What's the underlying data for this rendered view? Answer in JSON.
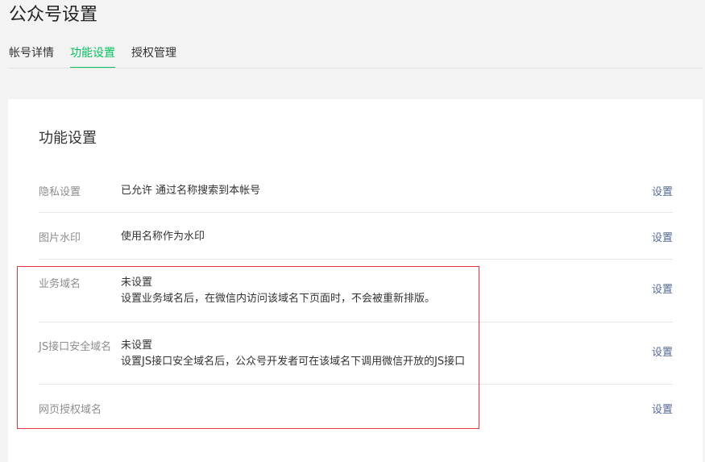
{
  "page_title": "公众号设置",
  "tabs": [
    {
      "label": "帐号详情",
      "active": false
    },
    {
      "label": "功能设置",
      "active": true
    },
    {
      "label": "授权管理",
      "active": false
    }
  ],
  "section_title": "功能设置",
  "rows": [
    {
      "label": "隐私设置",
      "value_line1": "已允许 通过名称搜索到本帐号",
      "value_line2": "",
      "action": "设置"
    },
    {
      "label": "图片水印",
      "value_line1": "使用名称作为水印",
      "value_line2": "",
      "action": "设置"
    },
    {
      "label": "业务域名",
      "value_line1": "未设置",
      "value_line2": "设置业务域名后，在微信内访问该域名下页面时，不会被重新排版。",
      "action": "设置"
    },
    {
      "label": "JS接口安全域名",
      "value_line1": "未设置",
      "value_line2": "设置JS接口安全域名后，公众号开发者可在该域名下调用微信开放的JS接口",
      "action": "设置"
    },
    {
      "label": "网页授权域名",
      "value_line1": "",
      "value_line2": "",
      "action": "设置"
    }
  ],
  "colors": {
    "accent": "#07c160",
    "link": "#576b95",
    "highlight": "#e0393e"
  }
}
